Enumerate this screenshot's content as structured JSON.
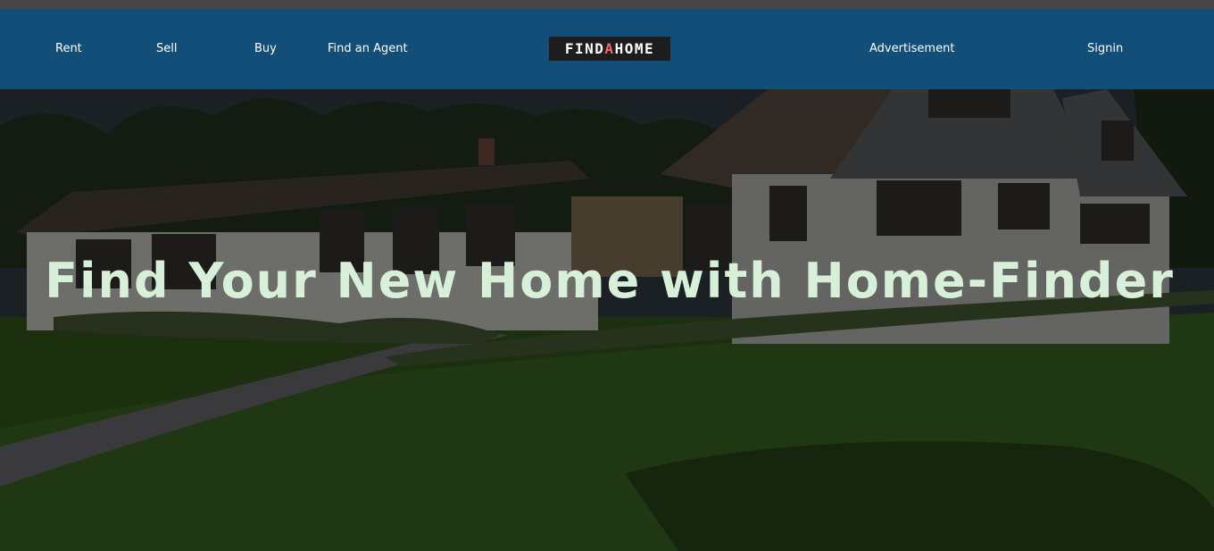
{
  "nav": {
    "rent": "Rent",
    "sell": "Sell",
    "buy": "Buy",
    "find_agent": "Find an Agent",
    "advertisement": "Advertisement",
    "signin": "Signin"
  },
  "logo": {
    "part1": "FIND",
    "part2": "A",
    "part3": "HOME"
  },
  "hero": {
    "title": "Find Your New Home with Home-Finder"
  },
  "colors": {
    "navbar": "#134e78",
    "topbar": "#454545",
    "logo_bg": "#1d1d1d",
    "logo_accent": "#f26a6a",
    "hero_text": "#d8f0da"
  }
}
